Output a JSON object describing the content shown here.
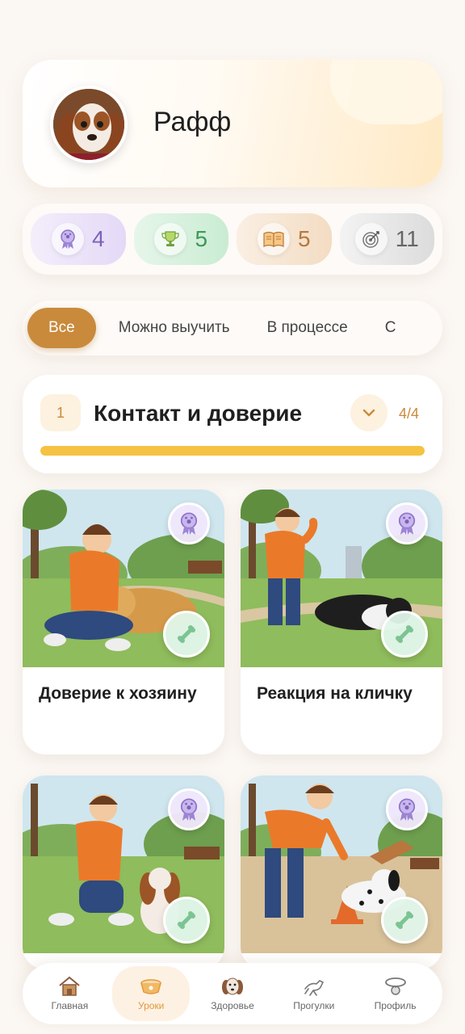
{
  "profile": {
    "name": "Рафф"
  },
  "stats": [
    {
      "icon": "award-ribbon-icon",
      "value": "4"
    },
    {
      "icon": "trophy-icon",
      "value": "5"
    },
    {
      "icon": "open-book-icon",
      "value": "5"
    },
    {
      "icon": "target-icon",
      "value": "11"
    }
  ],
  "filters": {
    "items": [
      "Все",
      "Можно выучить",
      "В процессе",
      "С"
    ],
    "selected": "Все"
  },
  "section": {
    "number": "1",
    "title": "Контакт и доверие",
    "count": "4/4",
    "progress": 1.0
  },
  "lessons": [
    {
      "title": "Доверие к хозяину"
    },
    {
      "title": "Реакция на кличку"
    },
    {
      "title": ""
    },
    {
      "title": ""
    }
  ],
  "nav": {
    "items": [
      {
        "label": "Главная",
        "icon": "house-icon"
      },
      {
        "label": "Уроки",
        "icon": "dog-bowl-icon"
      },
      {
        "label": "Здоровье",
        "icon": "dog-head-icon"
      },
      {
        "label": "Прогулки",
        "icon": "running-dog-icon"
      },
      {
        "label": "Профиль",
        "icon": "collar-tag-icon"
      }
    ],
    "active": "Уроки"
  },
  "colors": {
    "accent": "#c98a3c",
    "progress": "#f5c242",
    "nav_active": "#e1993e"
  }
}
